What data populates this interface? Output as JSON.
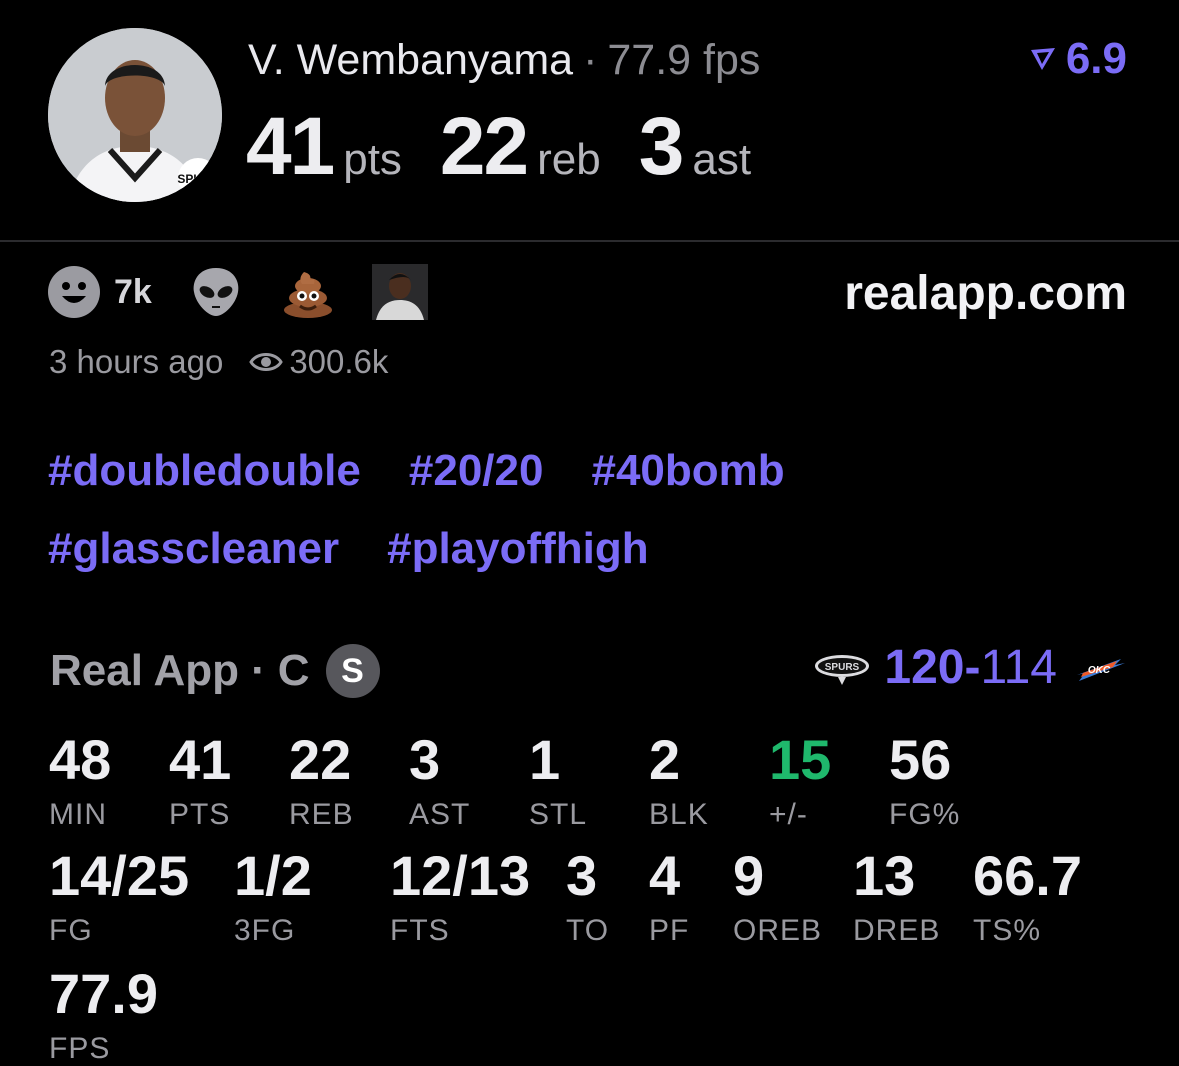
{
  "player": {
    "name": "V. Wembanyama",
    "separator": "·",
    "fps_label": "77.9 fps",
    "pts": "41",
    "pts_unit": "pts",
    "reb": "22",
    "reb_unit": "reb",
    "ast": "3",
    "ast_unit": "ast"
  },
  "rating": {
    "value": "6.9",
    "icon": "real-rating-icon",
    "color": "#7b6cf6"
  },
  "reactions": [
    {
      "icon": "smiley-face-icon",
      "count": "7k"
    },
    {
      "icon": "alien-face-icon"
    },
    {
      "icon": "poop-emoji-icon"
    },
    {
      "icon": "user-avatar-icon"
    }
  ],
  "site": "realapp.com",
  "meta": {
    "time": "3 hours ago",
    "views_icon": "eye-icon",
    "views": "300.6k"
  },
  "tags": [
    "#doubledouble",
    "#20/20",
    "#40bomb",
    "#glasscleaner",
    "#playoffhigh"
  ],
  "game": {
    "source": "Real App",
    "dot": "·",
    "position": "C",
    "badge": "S",
    "home_logo": "spurs-logo",
    "away_logo": "thunder-logo",
    "home_score": "120",
    "dash": "-",
    "away_score": "114"
  },
  "stats": [
    {
      "value": "48",
      "label": "MIN"
    },
    {
      "value": "41",
      "label": "PTS"
    },
    {
      "value": "22",
      "label": "REB"
    },
    {
      "value": "3",
      "label": "AST"
    },
    {
      "value": "1",
      "label": "STL"
    },
    {
      "value": "2",
      "label": "BLK"
    },
    {
      "value": "15",
      "label": "+/-"
    },
    {
      "value": "56",
      "label": "FG%"
    },
    {
      "value": "14/25",
      "label": "FG"
    },
    {
      "value": "1/2",
      "label": "3FG"
    },
    {
      "value": "12/13",
      "label": "FTS"
    },
    {
      "value": "3",
      "label": "TO"
    },
    {
      "value": "4",
      "label": "PF"
    },
    {
      "value": "9",
      "label": "OREB"
    },
    {
      "value": "13",
      "label": "DREB"
    },
    {
      "value": "66.7",
      "label": "TS%"
    },
    {
      "value": "77.9",
      "label": "FPS"
    }
  ],
  "colors": {
    "accent": "#7b6cf6",
    "positive": "#1fb86c",
    "background": "#000000"
  }
}
